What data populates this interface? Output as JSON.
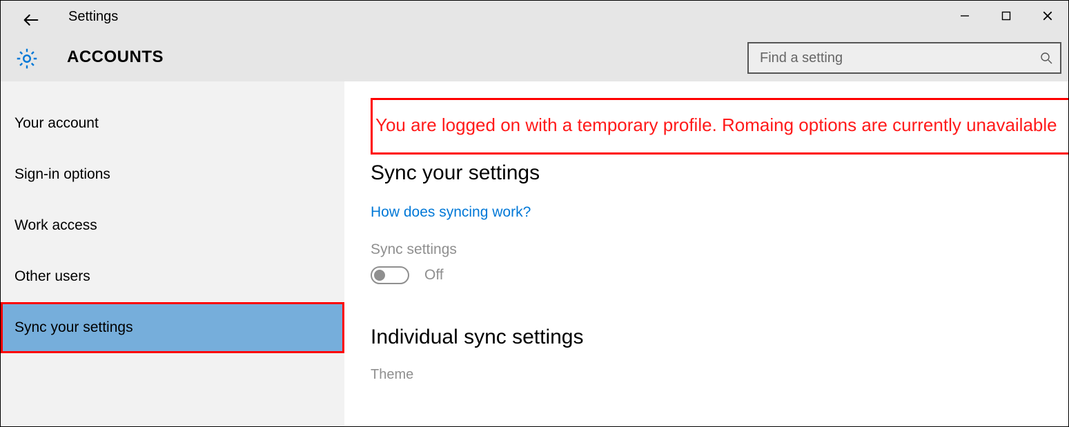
{
  "window": {
    "title": "Settings",
    "minimize": "–",
    "maximize": "☐",
    "close": "✕"
  },
  "section": {
    "title": "ACCOUNTS"
  },
  "search": {
    "placeholder": "Find a setting"
  },
  "sidebar": {
    "items": [
      {
        "label": "Your account"
      },
      {
        "label": "Sign-in options"
      },
      {
        "label": "Work access"
      },
      {
        "label": "Other users"
      },
      {
        "label": "Sync your settings",
        "selected": true
      }
    ]
  },
  "content": {
    "error": "You are logged on with a temporary profile. Romaing options are currently unavailable",
    "heading": "Sync your settings",
    "link": "How does syncing work?",
    "toggle_label": "Sync settings",
    "toggle_state": "Off",
    "subheading": "Individual sync settings",
    "cutoff_label": "Theme"
  }
}
